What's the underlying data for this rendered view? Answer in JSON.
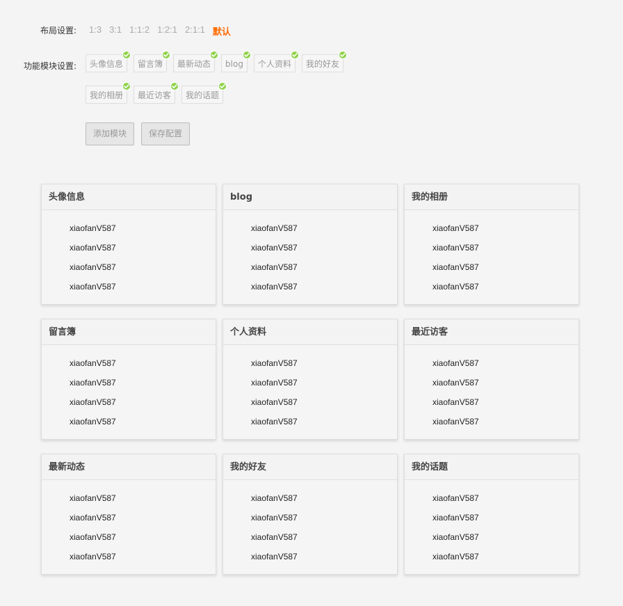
{
  "settings": {
    "layout_label": "布局设置:",
    "layout_options": [
      "1:3",
      "3:1",
      "1:1:2",
      "1:2:1",
      "2:1:1",
      "默认"
    ],
    "module_label": "功能模块设置:",
    "module_tags_row1": [
      "头像信息",
      "留言簿",
      "最新动态",
      "blog",
      "个人资料",
      "我的好友"
    ],
    "module_tags_row2": [
      "我的相册",
      "最近访客",
      "我的话题"
    ],
    "add_module_button": "添加模块",
    "save_config_button": "保存配置"
  },
  "modules": [
    {
      "title": "头像信息",
      "items": [
        "xiaofanV587",
        "xiaofanV587",
        "xiaofanV587",
        "xiaofanV587"
      ]
    },
    {
      "title": "blog",
      "items": [
        "xiaofanV587",
        "xiaofanV587",
        "xiaofanV587",
        "xiaofanV587"
      ]
    },
    {
      "title": "我的相册",
      "items": [
        "xiaofanV587",
        "xiaofanV587",
        "xiaofanV587",
        "xiaofanV587"
      ]
    },
    {
      "title": "留言簿",
      "items": [
        "xiaofanV587",
        "xiaofanV587",
        "xiaofanV587",
        "xiaofanV587"
      ]
    },
    {
      "title": "个人资料",
      "items": [
        "xiaofanV587",
        "xiaofanV587",
        "xiaofanV587",
        "xiaofanV587"
      ]
    },
    {
      "title": "最近访客",
      "items": [
        "xiaofanV587",
        "xiaofanV587",
        "xiaofanV587",
        "xiaofanV587"
      ]
    },
    {
      "title": "最新动态",
      "items": [
        "xiaofanV587",
        "xiaofanV587",
        "xiaofanV587",
        "xiaofanV587"
      ]
    },
    {
      "title": "我的好友",
      "items": [
        "xiaofanV587",
        "xiaofanV587",
        "xiaofanV587",
        "xiaofanV587"
      ]
    },
    {
      "title": "我的话题",
      "items": [
        "xiaofanV587",
        "xiaofanV587",
        "xiaofanV587",
        "xiaofanV587"
      ]
    }
  ],
  "colors": {
    "active_layout": "#ff6a00",
    "check_badge": "#8fd24a"
  },
  "icons": {
    "tag_badge": "check-icon"
  }
}
